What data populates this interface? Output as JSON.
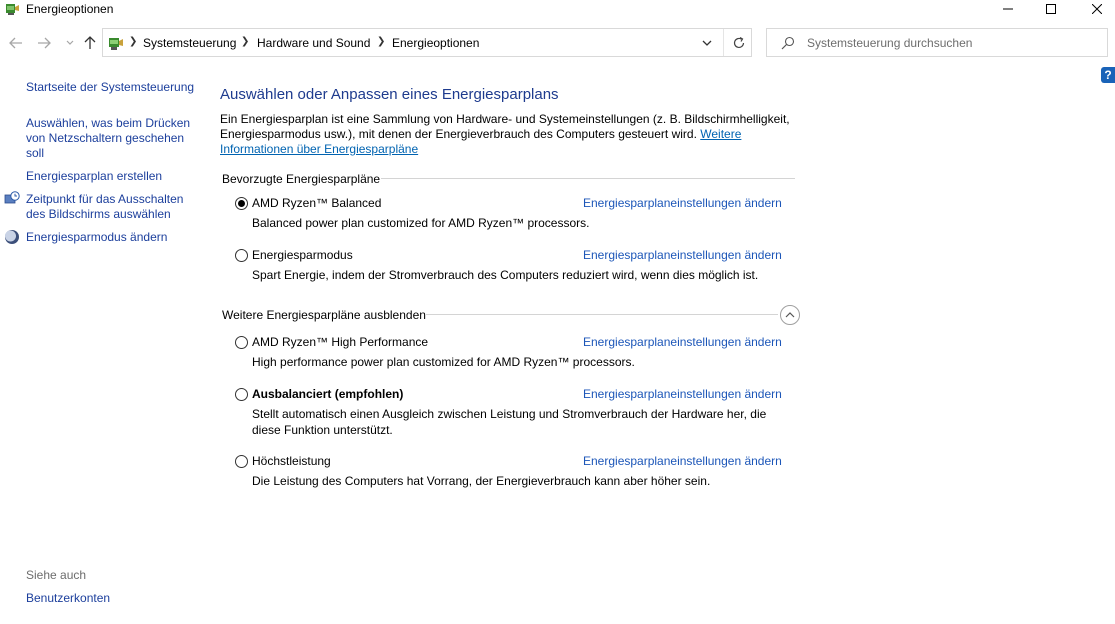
{
  "window": {
    "title": "Energieoptionen",
    "icon": "power-options-icon"
  },
  "navigation": {
    "breadcrumb": [
      "Systemsteuerung",
      "Hardware und Sound",
      "Energieoptionen"
    ],
    "search_placeholder": "Systemsteuerung durchsuchen"
  },
  "help": {
    "label": "?"
  },
  "sidebar": {
    "items": [
      {
        "label": "Startseite der Systemsteuerung"
      },
      {
        "label_lines": [
          "Auswählen, was beim Drücken",
          "von Netzschaltern geschehen",
          "soll"
        ]
      },
      {
        "label": "Energiesparplan erstellen"
      },
      {
        "label_lines": [
          "Zeitpunkt für das Ausschalten",
          "des Bildschirms auswählen"
        ],
        "icon": "clock-monitor-icon"
      },
      {
        "label": "Energiesparmodus ändern",
        "icon": "moon-icon"
      }
    ],
    "see_also_label": "Siehe auch",
    "see_also_items": [
      {
        "label": "Benutzerkonten"
      }
    ]
  },
  "main": {
    "title": "Auswählen oder Anpassen eines Energiesparplans",
    "description_line1": "Ein Energiesparplan ist eine Sammlung von Hardware- und Systemeinstellungen (z. B. Bildschirmhelligkeit,",
    "description_line2": "Energiesparmodus usw.), mit denen der Energieverbrauch des Computers gesteuert wird.",
    "more_info_link_part1": "Weitere",
    "more_info_link_part2": "Informationen über Energiesparpläne",
    "preferred_header": "Bevorzugte Energiesparpläne",
    "hidden_header": "Weitere Energiesparpläne ausblenden",
    "change_link_label": "Energiesparplaneinstellungen ändern",
    "preferred_plans": [
      {
        "name": "AMD Ryzen™ Balanced",
        "desc": "Balanced power plan customized for AMD Ryzen™ processors.",
        "selected": true
      },
      {
        "name": "Energiesparmodus",
        "desc": "Spart Energie, indem der Stromverbrauch des Computers reduziert wird, wenn dies möglich ist.",
        "selected": false
      }
    ],
    "additional_plans": [
      {
        "name": "AMD Ryzen™ High Performance",
        "desc": "High performance power plan customized for AMD Ryzen™ processors.",
        "selected": false
      },
      {
        "name": "Ausbalanciert (empfohlen)",
        "desc_line1": "Stellt automatisch einen Ausgleich zwischen Leistung und Stromverbrauch der Hardware her, die",
        "desc_line2": "diese Funktion unterstützt.",
        "selected": false,
        "bold": true
      },
      {
        "name": "Höchstleistung",
        "desc": "Die Leistung des Computers hat Vorrang, der Energieverbrauch kann aber höher sein.",
        "selected": false
      }
    ]
  }
}
